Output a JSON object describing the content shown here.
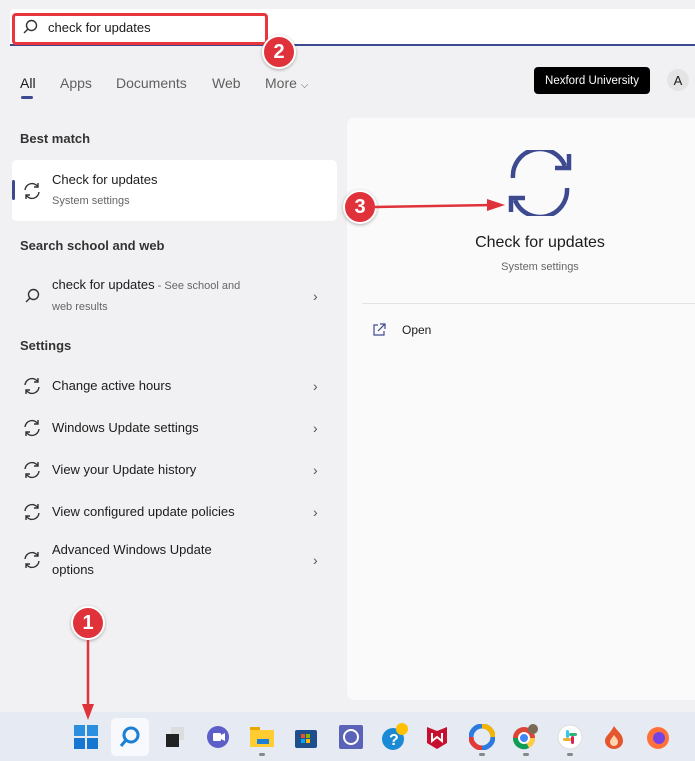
{
  "search": {
    "query": "check for updates"
  },
  "tabs": [
    "All",
    "Apps",
    "Documents",
    "Web",
    "More"
  ],
  "org_button": "Nexford University",
  "avatar": "A",
  "best_match": {
    "heading": "Best match",
    "title": "Check for updates",
    "subtitle": "System settings"
  },
  "school_web": {
    "heading": "Search school and web",
    "query": "check for updates",
    "suffix": " - See school and",
    "suffix2": "web results"
  },
  "settings": {
    "heading": "Settings",
    "items": [
      "Change active hours",
      "Windows Update settings",
      "View your Update history",
      "View configured update policies",
      "Advanced Windows Update",
      "options"
    ]
  },
  "preview": {
    "title": "Check for updates",
    "subtitle": "System settings",
    "open_label": "Open"
  },
  "annotations": [
    "1",
    "2",
    "3"
  ],
  "colors": {
    "accent": "#3e4a8f",
    "annotation": "#e0323a"
  }
}
